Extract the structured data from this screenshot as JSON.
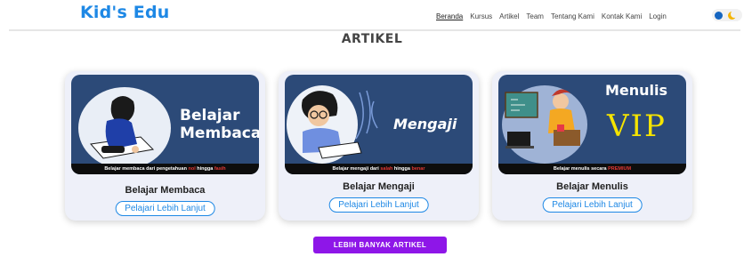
{
  "brand": "Kid's Edu",
  "nav": {
    "items": [
      "Beranda",
      "Kursus",
      "Artikel",
      "Team",
      "Tentang Kami",
      "Kontak Kami",
      "Login"
    ],
    "active": "Beranda"
  },
  "section_title": "ARTIKEL",
  "cards": [
    {
      "image_heading": "Belajar Membaca",
      "image_caption_parts": [
        "Belajar membaca dari pengetahuan ",
        "nol",
        " hingga ",
        "fasih"
      ],
      "title": "Belajar Membaca",
      "button": "Pelajari Lebih Lanjut"
    },
    {
      "image_heading": "Mengaji",
      "image_caption_parts": [
        "Belajar mengaji dari ",
        "salah",
        " hingga ",
        "benar"
      ],
      "title": "Belajar Mengaji",
      "button": "Pelajari Lebih Lanjut"
    },
    {
      "image_heading_1": "Menulis",
      "image_heading_2": "VIP",
      "image_caption_parts": [
        "Belajar menulis secara ",
        "PREMIUM"
      ],
      "title": "Belajar Menulis",
      "button": "Pelajari Lebih Lanjut"
    }
  ],
  "more_button": "LEBIH BANYAK ARTIKEL",
  "colors": {
    "brand": "#1e88e5",
    "card_image_bg": "#2c4a78",
    "more_button_bg": "#8e16e8",
    "caption_highlight": "#e53935"
  },
  "icons": [
    "sun-toggle-icon",
    "moon-icon"
  ]
}
